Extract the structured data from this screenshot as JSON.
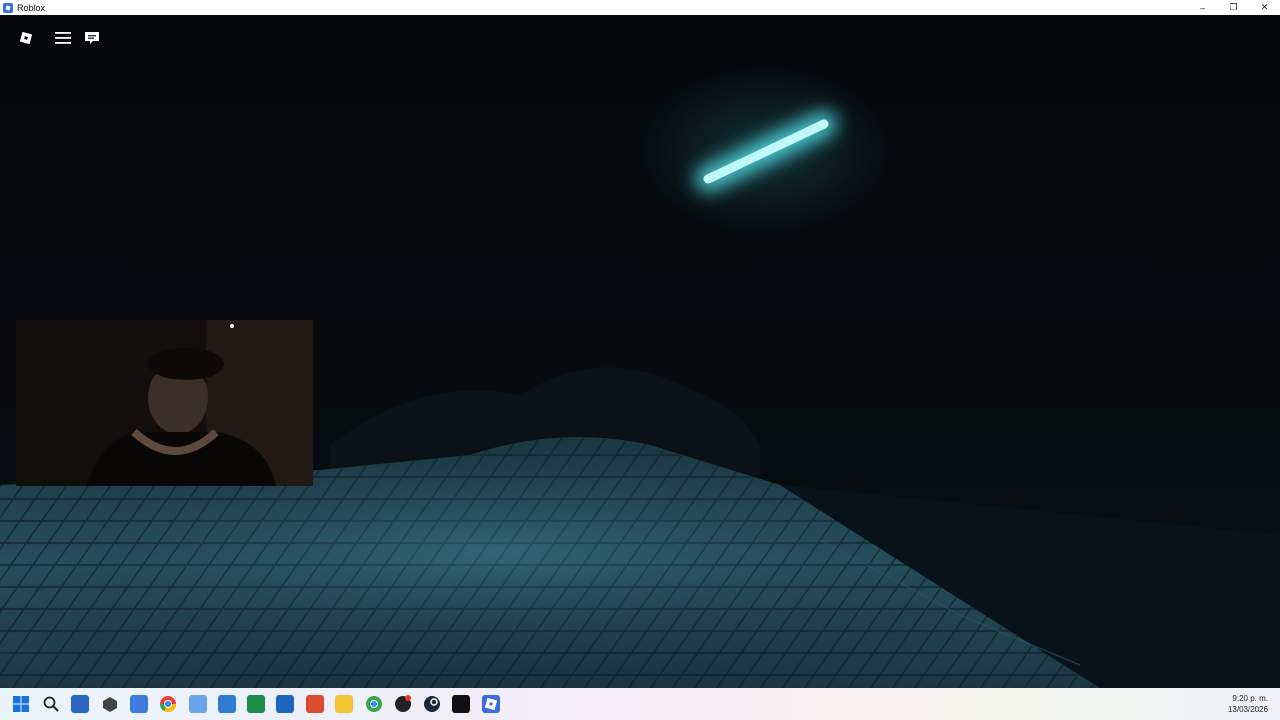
{
  "window": {
    "title": "Roblox",
    "controls": [
      "–",
      "❐",
      "✕"
    ]
  },
  "roblox_ui": {
    "buttons": [
      "roblox-logo",
      "menu",
      "chat"
    ]
  },
  "taskbar": {
    "icons": [
      "windows-start-icon",
      "search-icon",
      "store-icon",
      "cube-icon",
      "visual-studio-icon",
      "chrome-icon",
      "snipping-tool-icon",
      "outlook-icon",
      "excel-icon",
      "mail-icon",
      "office-icon",
      "file-explorer-icon",
      "chrome-profile-icon",
      "github-icon",
      "steam-icon",
      "epic-games-icon",
      "roblox-icon"
    ],
    "time": "9:20 p. m.",
    "date": "13/03/2026"
  },
  "colors": {
    "accent": "#3b6bde",
    "light": "#7ff3f3",
    "floor": "#2a5666"
  }
}
